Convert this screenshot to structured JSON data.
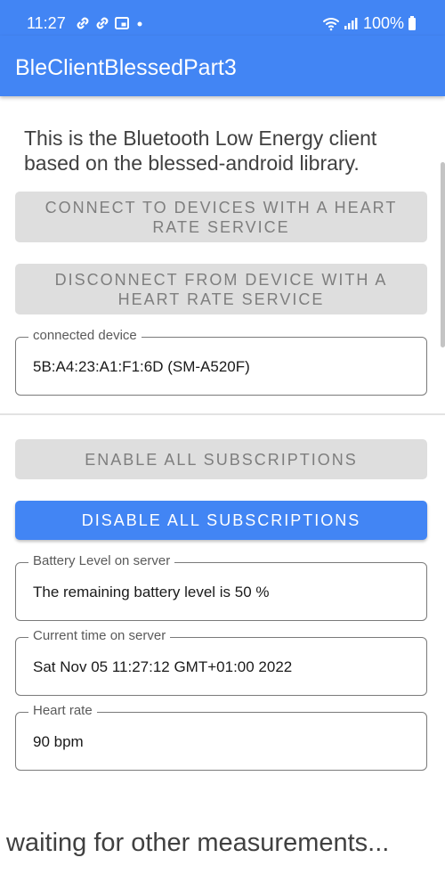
{
  "status_bar": {
    "time": "11:27",
    "battery": "100%",
    "icons_left": [
      "link-icon",
      "link-icon",
      "cast-icon",
      "dot-icon"
    ],
    "icons_right": [
      "wifi-icon",
      "signal-icon",
      "battery-icon"
    ]
  },
  "app": {
    "title": "BleClientBlessedPart3"
  },
  "intro": {
    "text": "This is the Bluetooth Low Energy client based on the blessed-android library."
  },
  "buttons": {
    "connect": "Connect to devices with a heart rate service",
    "disconnect": "Disconnect from device with a heart rate service",
    "enable_subscriptions": "Enable all subscriptions",
    "disable_subscriptions": "Disable all subscriptions"
  },
  "fields": {
    "connected_device": {
      "label": "connected device",
      "value": "5B:A4:23:A1:F1:6D (SM-A520F)"
    },
    "battery_level": {
      "label": "Battery Level on server",
      "value": "The remaining battery level is 50 %"
    },
    "current_time": {
      "label": "Current time on server",
      "value": "Sat Nov 05 11:27:12 GMT+01:00 2022"
    },
    "heart_rate": {
      "label": "Heart rate",
      "value": "90 bpm"
    }
  },
  "footer": {
    "waiting": "waiting for other measurements..."
  },
  "colors": {
    "primary": "#4285f4",
    "disabled_button_bg": "#dedede",
    "disabled_button_text": "#7e7e7e",
    "field_border": "#7a7a7a"
  }
}
